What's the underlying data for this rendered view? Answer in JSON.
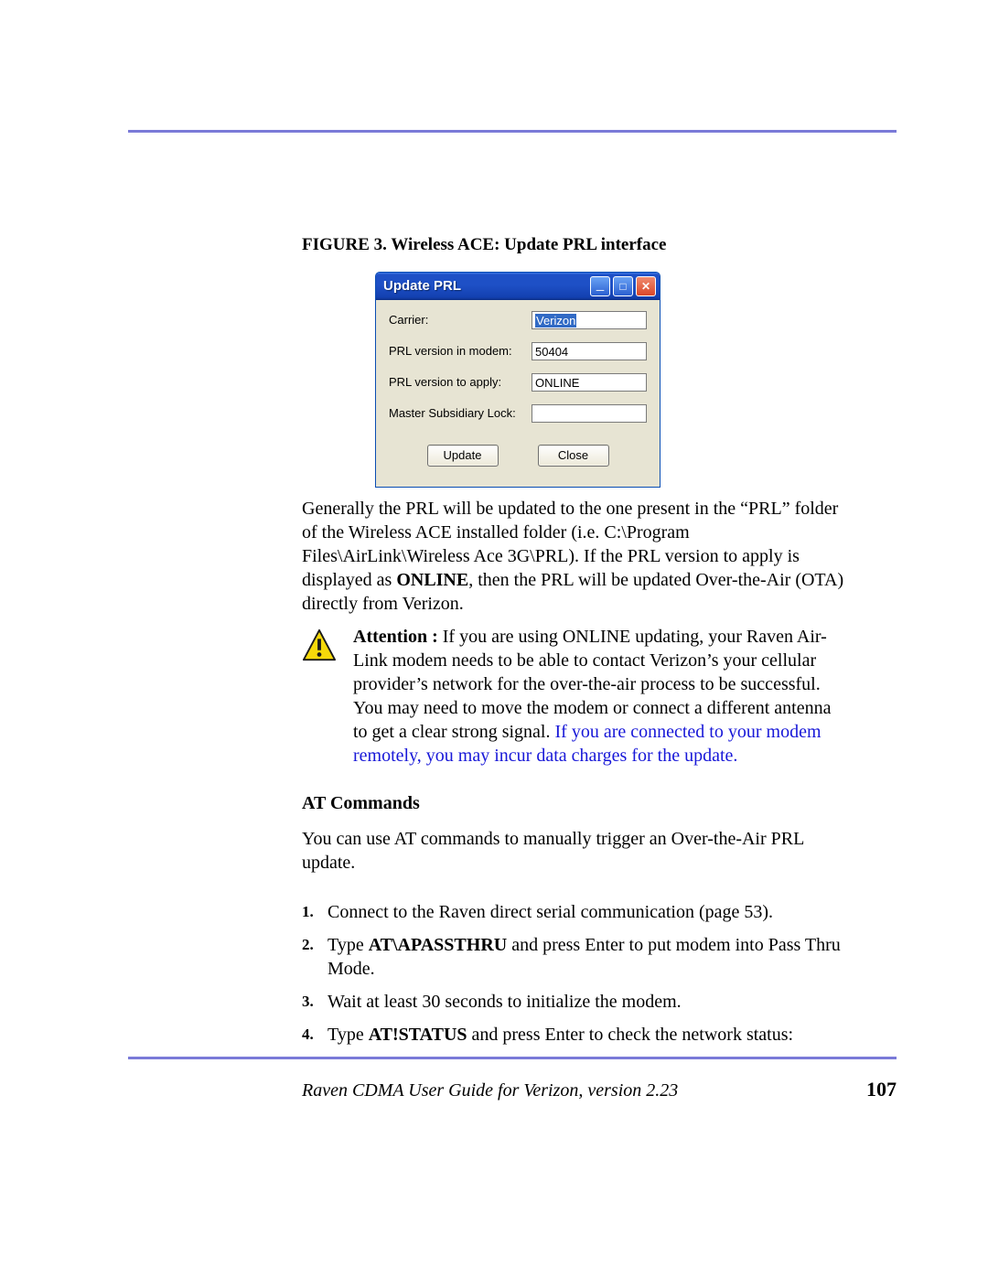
{
  "figure": {
    "label": "FIGURE 3.",
    "title": "Wireless ACE: Update PRL interface"
  },
  "window": {
    "title": "Update PRL",
    "fields": {
      "carrier": {
        "label": "Carrier:",
        "value": "Verizon"
      },
      "prl_in_modem": {
        "label": "PRL version in modem:",
        "value": "50404"
      },
      "prl_to_apply": {
        "label": "PRL version to apply:",
        "value": "ONLINE"
      },
      "msl": {
        "label": "Master Subsidiary Lock:",
        "value": ""
      }
    },
    "buttons": {
      "update": "Update",
      "close": "Close"
    }
  },
  "para1_a": "Generally the PRL will be updated to the one present in the “PRL” folder of the Wireless ACE installed folder (i.e. C:\\Program Files\\AirLink\\Wireless Ace 3G\\PRL).  If the PRL version to apply is displayed as ",
  "para1_bold": "ONLINE",
  "para1_b": ", then the PRL will be updated Over-the-Air (OTA) directly from Verizon.",
  "attention": {
    "label": "Attention :",
    "text": " If you are using ONLINE updating, your Raven Air-Link modem needs to be able to contact Verizon’s your cellular provider’s network for the over-the-air process to be successful. You may need to move the modem or connect a different antenna to get a clear strong signal. ",
    "link": "If you are connected to your modem remotely, you may incur data charges for the update."
  },
  "subhead": "AT Commands",
  "para2": "You can use AT commands to manually trigger an Over-the-Air PRL update.",
  "steps": [
    {
      "n": "1.",
      "a": "Connect to the Raven direct serial communication (page 53)."
    },
    {
      "n": "2.",
      "a": "Type ",
      "cmd": "AT\\APASSTHRU",
      "b": " and press Enter to put modem into Pass Thru Mode."
    },
    {
      "n": "3.",
      "a": "Wait at least 30 seconds to initialize the modem."
    },
    {
      "n": "4.",
      "a": "Type ",
      "cmd": "AT!STATUS",
      "b": " and press Enter to check the network status:"
    }
  ],
  "footer": {
    "title": "Raven CDMA User Guide for Verizon, version 2.23",
    "page": "107"
  }
}
